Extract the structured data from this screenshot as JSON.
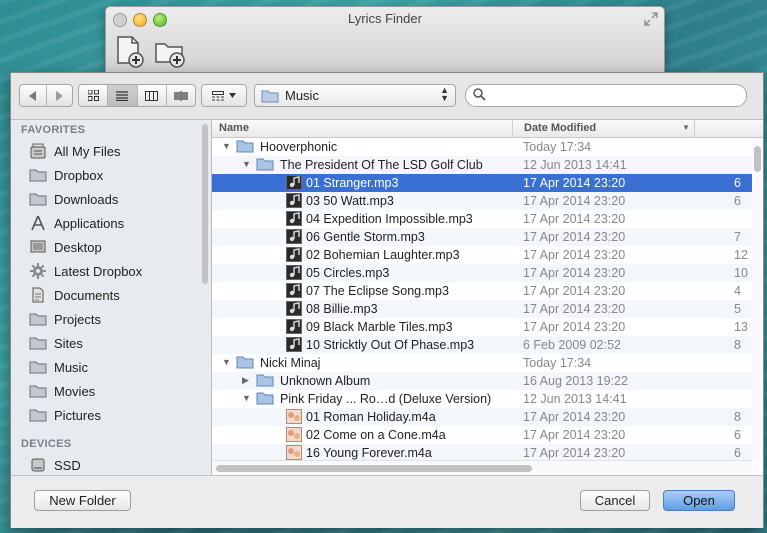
{
  "window": {
    "title": "Lyrics Finder"
  },
  "colors": {
    "selection": "#3a6fd3",
    "open_button": "#6aa6ea"
  },
  "toolbar": {
    "path_label": "Music",
    "search_placeholder": ""
  },
  "sidebar": {
    "favorites_heading": "FAVORITES",
    "favorites": [
      {
        "label": "All My Files",
        "icon": "all-files-icon"
      },
      {
        "label": "Dropbox",
        "icon": "folder-icon"
      },
      {
        "label": "Downloads",
        "icon": "folder-icon"
      },
      {
        "label": "Applications",
        "icon": "applications-icon"
      },
      {
        "label": "Desktop",
        "icon": "desktop-icon"
      },
      {
        "label": "Latest Dropbox",
        "icon": "gear-icon"
      },
      {
        "label": "Documents",
        "icon": "documents-icon"
      },
      {
        "label": "Projects",
        "icon": "folder-icon"
      },
      {
        "label": "Sites",
        "icon": "folder-icon"
      },
      {
        "label": "Music",
        "icon": "folder-icon"
      },
      {
        "label": "Movies",
        "icon": "folder-icon"
      },
      {
        "label": "Pictures",
        "icon": "folder-icon"
      }
    ],
    "devices_heading": "DEVICES",
    "devices": [
      {
        "label": "SSD",
        "icon": "disk-icon"
      }
    ]
  },
  "columns": {
    "name": "Name",
    "date": "Date Modified"
  },
  "rows": [
    {
      "name": "Hooverphonic",
      "date": "Today 17:34",
      "size": "",
      "indent": 0,
      "kind": "folder",
      "expanded": true
    },
    {
      "name": "The President Of The LSD Golf Club",
      "date": "12 Jun 2013 14:41",
      "size": "",
      "indent": 1,
      "kind": "folder",
      "expanded": true
    },
    {
      "name": "01 Stranger.mp3",
      "date": "17 Apr 2014 23:20",
      "size": "6",
      "indent": 2,
      "kind": "mp3",
      "selected": true
    },
    {
      "name": "03 50 Watt.mp3",
      "date": "17 Apr 2014 23:20",
      "size": "6",
      "indent": 2,
      "kind": "mp3"
    },
    {
      "name": "04 Expedition Impossible.mp3",
      "date": "17 Apr 2014 23:20",
      "size": "",
      "indent": 2,
      "kind": "mp3"
    },
    {
      "name": "06 Gentle Storm.mp3",
      "date": "17 Apr 2014 23:20",
      "size": "7",
      "indent": 2,
      "kind": "mp3"
    },
    {
      "name": "02 Bohemian Laughter.mp3",
      "date": "17 Apr 2014 23:20",
      "size": "12",
      "indent": 2,
      "kind": "mp3"
    },
    {
      "name": "05 Circles.mp3",
      "date": "17 Apr 2014 23:20",
      "size": "10",
      "indent": 2,
      "kind": "mp3"
    },
    {
      "name": "07 The Eclipse Song.mp3",
      "date": "17 Apr 2014 23:20",
      "size": "4",
      "indent": 2,
      "kind": "mp3"
    },
    {
      "name": "08 Billie.mp3",
      "date": "17 Apr 2014 23:20",
      "size": "5",
      "indent": 2,
      "kind": "mp3"
    },
    {
      "name": "09 Black Marble Tiles.mp3",
      "date": "17 Apr 2014 23:20",
      "size": "13",
      "indent": 2,
      "kind": "mp3"
    },
    {
      "name": "10 Stricktly Out Of Phase.mp3",
      "date": "6 Feb 2009 02:52",
      "size": "8",
      "indent": 2,
      "kind": "mp3"
    },
    {
      "name": "Nicki Minaj",
      "date": "Today 17:34",
      "size": "",
      "indent": 0,
      "kind": "folder",
      "expanded": true
    },
    {
      "name": "Unknown Album",
      "date": "16 Aug 2013 19:22",
      "size": "",
      "indent": 1,
      "kind": "folder",
      "expanded": false
    },
    {
      "name": "Pink Friday ... Ro…d (Deluxe Version)",
      "date": "12 Jun 2013 14:41",
      "size": "",
      "indent": 1,
      "kind": "folder",
      "expanded": true
    },
    {
      "name": "01 Roman Holiday.m4a",
      "date": "17 Apr 2014 23:20",
      "size": "8",
      "indent": 2,
      "kind": "m4a"
    },
    {
      "name": "02 Come on a Cone.m4a",
      "date": "17 Apr 2014 23:20",
      "size": "6",
      "indent": 2,
      "kind": "m4a"
    },
    {
      "name": "16 Young Forever.m4a",
      "date": "17 Apr 2014 23:20",
      "size": "6",
      "indent": 2,
      "kind": "m4a"
    }
  ],
  "buttons": {
    "new_folder": "New Folder",
    "cancel": "Cancel",
    "open": "Open"
  }
}
